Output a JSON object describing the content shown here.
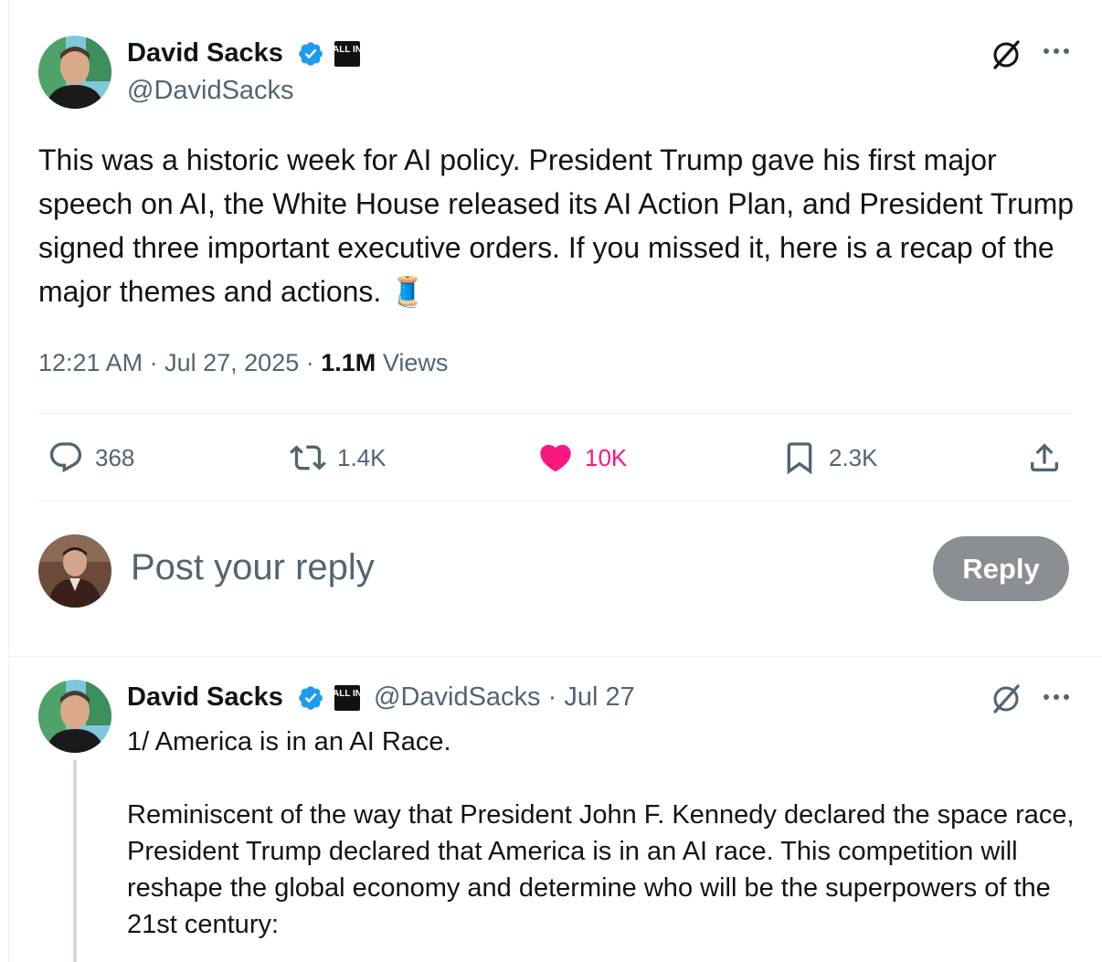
{
  "main_tweet": {
    "author_name": "David Sacks",
    "author_handle": "@DavidSacks",
    "affiliate_badge": "ALL IN",
    "text": "This was a historic week for AI policy. President Trump gave his first major speech on AI, the White House released its AI Action Plan, and President Trump signed three important executive orders. If you missed it, here is a recap of the major themes and actions. 🧵",
    "time": "12:21 AM",
    "date": "Jul 27, 2025",
    "separator": "·",
    "views_count": "1.1M",
    "views_label": "Views",
    "stats": {
      "replies": "368",
      "reposts": "1.4K",
      "likes": "10K",
      "bookmarks": "2.3K"
    }
  },
  "reply_box": {
    "placeholder": "Post your reply",
    "button_label": "Reply"
  },
  "thread_reply": {
    "author_name": "David Sacks",
    "author_handle": "@DavidSacks",
    "dot": "·",
    "date": "Jul 27",
    "affiliate_badge": "ALL IN",
    "line1": "1/ America is in an AI Race.",
    "paragraph": "Reminiscent of the way that President John F. Kennedy declared the space race, President Trump declared that America is in an AI race. This competition will reshape the global economy and determine who will be the superpowers of the 21st century:"
  },
  "icons": {
    "verified": "verified-badge-icon",
    "grok": "grok-icon",
    "more": "more-icon",
    "reply": "reply-icon",
    "repost": "repost-icon",
    "like": "heart-icon",
    "bookmark": "bookmark-icon",
    "share": "share-icon"
  },
  "colors": {
    "verified_blue": "#1d9bf0",
    "like_pink": "#f91880",
    "secondary_text": "#536471",
    "reply_button_bg": "#8b8f93"
  }
}
